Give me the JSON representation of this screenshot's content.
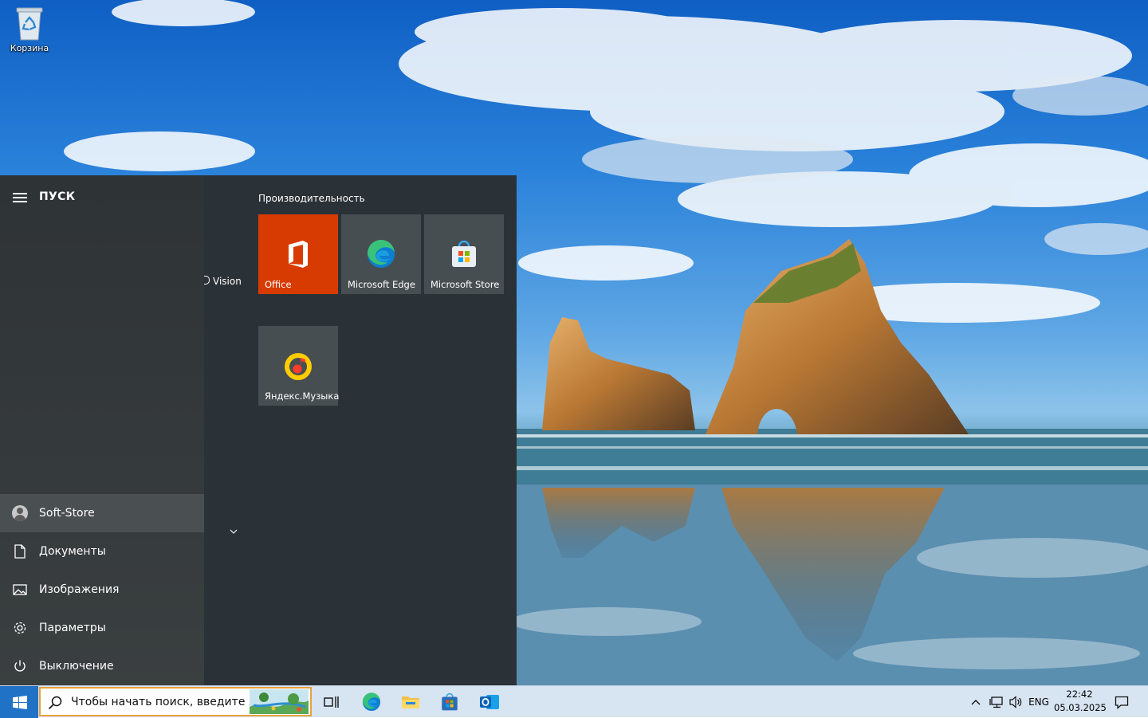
{
  "desktop": {
    "icons": [
      {
        "label": "Корзина",
        "icon": "recycle-bin-icon"
      }
    ]
  },
  "start_menu": {
    "title": "ПУСК",
    "user": "Soft-Store",
    "nav": [
      {
        "label": "Документы",
        "icon": "document-icon"
      },
      {
        "label": "Изображения",
        "icon": "pictures-icon"
      },
      {
        "label": "Параметры",
        "icon": "gear-icon"
      },
      {
        "label": "Выключение",
        "icon": "power-icon"
      }
    ],
    "app_list_fragment": "Vision",
    "group_title": "Производительность",
    "tiles": [
      {
        "label": "Office",
        "icon": "office-icon",
        "color": "#d83b01"
      },
      {
        "label": "Microsoft Edge",
        "icon": "edge-icon"
      },
      {
        "label": "Microsoft Store",
        "icon": "store-icon"
      },
      {
        "label": "Яндекс.Музыка",
        "icon": "yandex-music-icon"
      }
    ]
  },
  "taskbar": {
    "search_placeholder": "Чтобы начать поиск, введите з",
    "pinned": [
      "task-view-icon",
      "edge-icon",
      "file-explorer-icon",
      "store-icon",
      "outlook-icon"
    ],
    "tray": {
      "language": "ENG"
    },
    "clock": {
      "time": "22:42",
      "date": "05.03.2025"
    },
    "accent_color": "#1f72c6"
  }
}
